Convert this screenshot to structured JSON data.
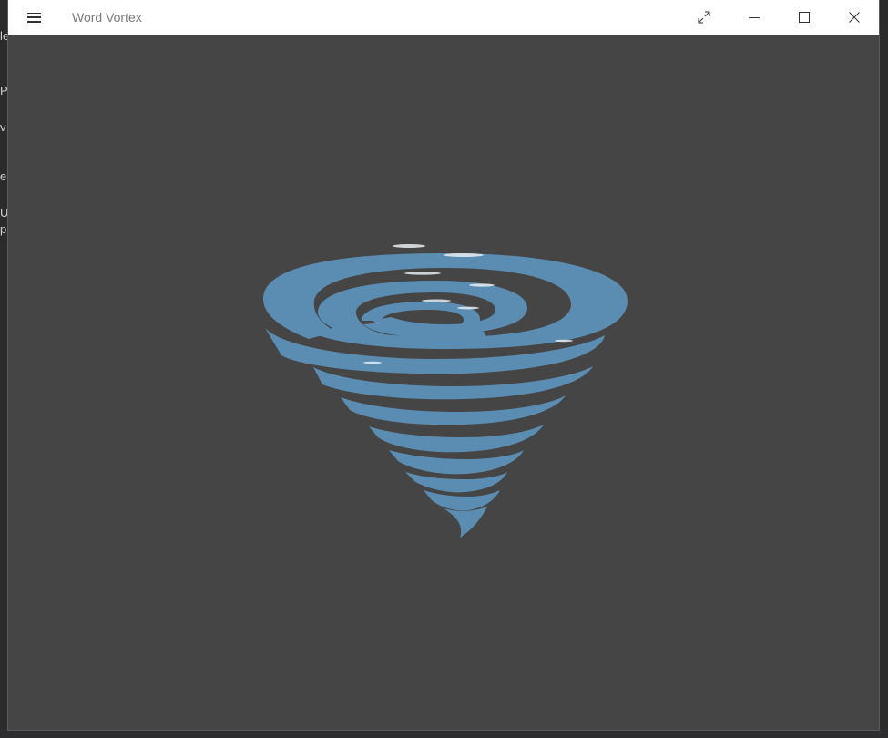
{
  "window": {
    "title": "Word Vortex",
    "accent_color": "#5b8db3",
    "background_color": "#454545"
  },
  "titlebar": {
    "menu_icon": "hamburger-icon",
    "fullscreen_icon": "expand-diagonal-icon",
    "minimize_icon": "minimize-icon",
    "maximize_icon": "maximize-icon",
    "close_icon": "close-icon"
  },
  "content": {
    "illustration": "tornado-vortex-logo"
  }
}
